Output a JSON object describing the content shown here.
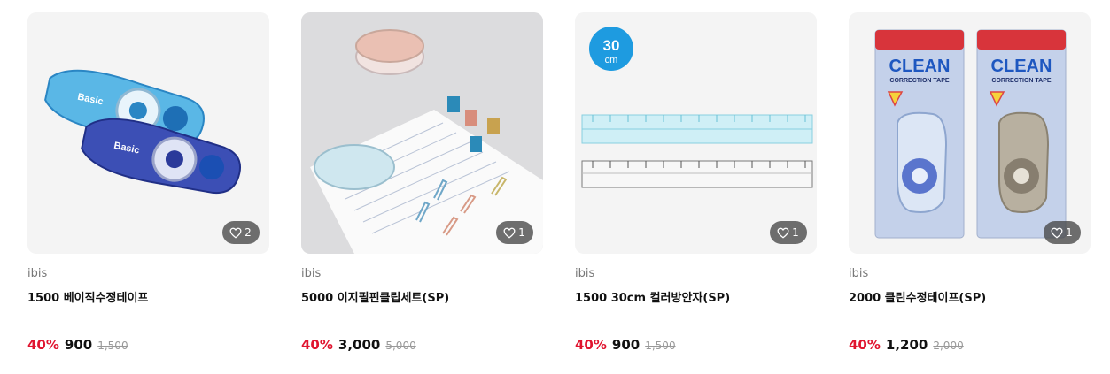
{
  "colors": {
    "discount": "#e0142f",
    "like_badge": "#464646",
    "thumb_bg": "#f4f4f4"
  },
  "products": [
    {
      "image": "correction-tape-basic",
      "likes": "2",
      "brand": "ibis",
      "name": "1500 베이직수정테이프",
      "discount": "40%",
      "price": "900",
      "original_price": "1,500"
    },
    {
      "image": "easy-pin-clip-set",
      "likes": "1",
      "brand": "ibis",
      "name": "5000 이지필핀클립세트(SP)",
      "discount": "40%",
      "price": "3,000",
      "original_price": "5,000"
    },
    {
      "image": "color-grid-ruler",
      "badge_value": "30",
      "badge_unit": "cm",
      "likes": "1",
      "brand": "ibis",
      "name": "1500 30cm 컬러방안자(SP)",
      "discount": "40%",
      "price": "900",
      "original_price": "1,500"
    },
    {
      "image": "clean-correction-tape",
      "package_label": "CLEAN",
      "package_sublabel": "CORRECTION TAPE",
      "likes": "1",
      "brand": "ibis",
      "name": "2000 클린수정테이프(SP)",
      "discount": "40%",
      "price": "1,200",
      "original_price": "2,000"
    }
  ]
}
